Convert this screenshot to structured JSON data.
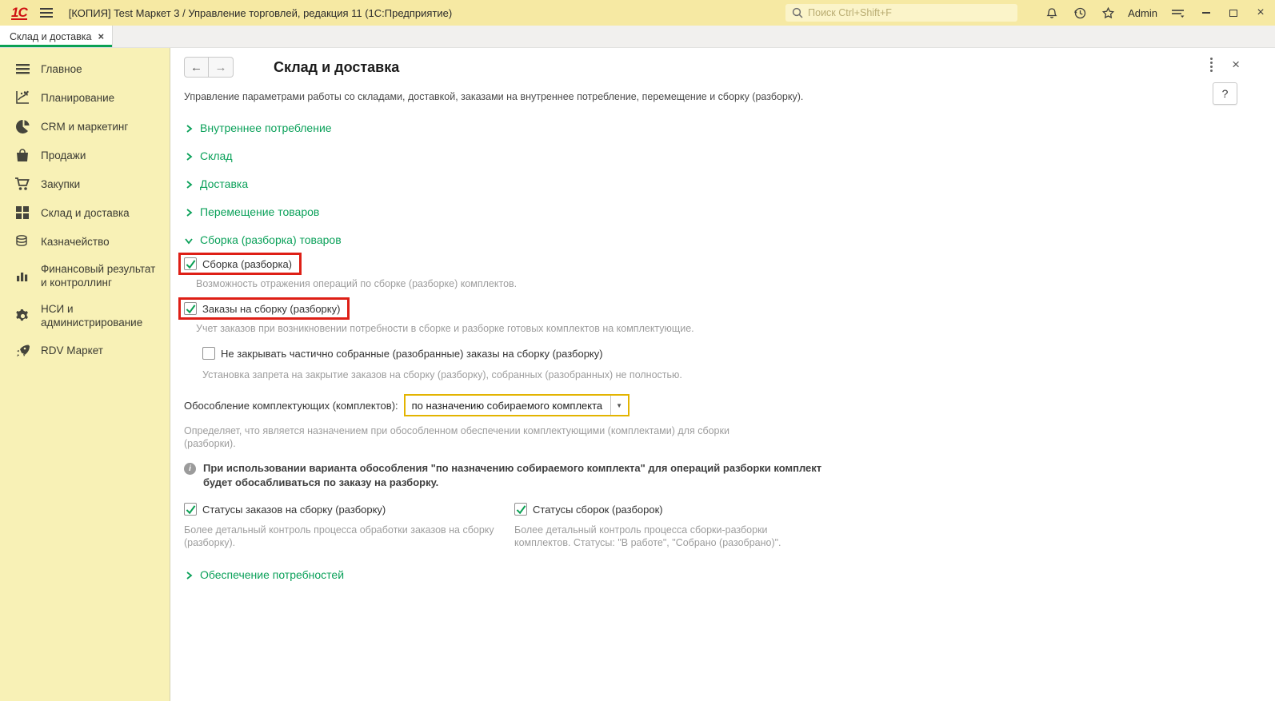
{
  "colors": {
    "titlebar_bg": "#f6e9a3",
    "sidebar_bg": "#f8f1b6",
    "accent_green": "#0ba15a",
    "highlight_red": "#de1f16",
    "highlight_gold": "#e3b400"
  },
  "titlebar": {
    "logo": "1С",
    "title": "[КОПИЯ] Test Маркет 3 / Управление торговлей, редакция 11  (1С:Предприятие)",
    "search_placeholder": "Поиск Ctrl+Shift+F",
    "user": "Admin"
  },
  "tabbar": {
    "active_tab": "Склад и доставка",
    "close_glyph": "×"
  },
  "sidebar": {
    "items": [
      {
        "label": "Главное"
      },
      {
        "label": "Планирование"
      },
      {
        "label": "CRM и маркетинг"
      },
      {
        "label": "Продажи"
      },
      {
        "label": "Закупки"
      },
      {
        "label": "Склад и доставка"
      },
      {
        "label": "Казначейство"
      },
      {
        "label": "Финансовый результат и контроллинг"
      },
      {
        "label": "НСИ и администрирование"
      },
      {
        "label": "RDV Маркет"
      }
    ]
  },
  "page": {
    "title": "Склад и доставка",
    "subtitle": "Управление параметрами работы со складами, доставкой, заказами на внутреннее потребление, перемещение и сборку (разборку).",
    "help_label": "?"
  },
  "sections": {
    "collapsed": [
      {
        "label": "Внутреннее потребление"
      },
      {
        "label": "Склад"
      },
      {
        "label": "Доставка"
      },
      {
        "label": "Перемещение товаров"
      }
    ],
    "expanded": {
      "label": "Сборка (разборка) товаров"
    },
    "bottom": {
      "label": "Обеспечение потребностей"
    }
  },
  "settings": {
    "assembly": {
      "label": "Сборка (разборка)",
      "checked": true,
      "description": "Возможность отражения операций по сборке (разборке) комплектов."
    },
    "orders": {
      "label": "Заказы на сборку (разборку)",
      "checked": true,
      "description": "Учет заказов при возникновении потребности в сборке и разборке готовых комплектов на комплектующие."
    },
    "no_close_partial": {
      "label": "Не закрывать частично собранные (разобранные) заказы на сборку (разборку)",
      "checked": false,
      "description": "Установка запрета на закрытие заказов на сборку (разборку), собранных (разобранных) не полностью."
    },
    "separation": {
      "label": "Обособление комплектующих (комплектов):",
      "value": "по назначению собираемого комплекта",
      "description": "Определяет, что является назначением при обособленном обеспечении комплектующими (комплектами) для сборки (разборки)."
    },
    "info_note": "При использовании варианта обособления \"по назначению собираемого комплекта\" для операций разборки комплект будет обосабливаться по заказу на разборку.",
    "order_statuses": {
      "label": "Статусы заказов на сборку (разборку)",
      "checked": true,
      "description": "Более детальный контроль процесса обработки заказов на сборку (разборку)."
    },
    "assembly_statuses": {
      "label": "Статусы сборок (разборок)",
      "checked": true,
      "description": "Более детальный контроль процесса сборки-разборки комплектов. Статусы: \"В работе\", \"Собрано (разобрано)\"."
    }
  }
}
